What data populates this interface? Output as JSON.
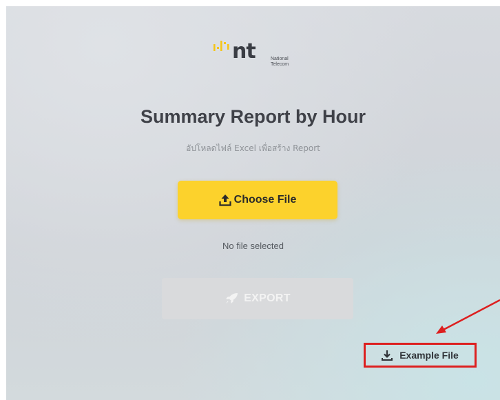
{
  "logo": {
    "brand": "nt",
    "subtitle_line1": "National",
    "subtitle_line2": "Telecom",
    "mark_icon": "nt-logo-mark",
    "accent_color": "#f5c518"
  },
  "page": {
    "title": "Summary Report by Hour",
    "subtitle": "อัปโหลดไฟล์ Excel เพื่อสร้าง Report"
  },
  "upload": {
    "button_label": "Choose File",
    "button_icon": "upload-icon",
    "status_text": "No file selected",
    "button_color": "#fcd22c"
  },
  "export": {
    "button_label": "EXPORT",
    "button_icon": "rocket-icon",
    "disabled": true
  },
  "example": {
    "link_label": "Example File",
    "link_icon": "download-icon",
    "highlight_color": "#dd1f1f"
  }
}
